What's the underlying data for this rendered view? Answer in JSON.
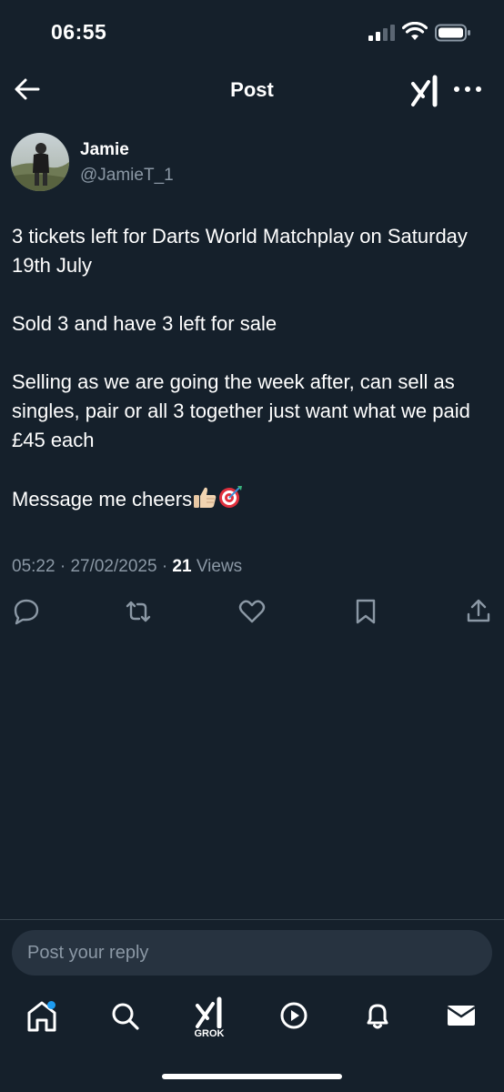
{
  "status_bar": {
    "time": "06:55"
  },
  "header": {
    "title": "Post"
  },
  "author": {
    "name": "Jamie",
    "handle": "@JamieT_1"
  },
  "tweet": {
    "paragraphs": [
      "3 tickets left for Darts World Matchplay on Saturday 19th July",
      "Sold 3 and have 3 left for sale",
      "Selling as we are going the week after, can sell as singles, pair or all 3 together just want what we paid £45 each",
      "Message me cheers"
    ],
    "emoji": [
      "👍🏼",
      "🎯"
    ],
    "time": "05:22",
    "separator": "·",
    "date": "27/02/2025",
    "views_count": "21",
    "views_label": "Views"
  },
  "actions": [
    "reply-icon",
    "retweet-icon",
    "like-icon",
    "bookmark-icon",
    "share-icon"
  ],
  "reply": {
    "placeholder": "Post your reply"
  },
  "tabbar": {
    "grok_label": "GROK",
    "items": [
      "home-icon",
      "search-icon",
      "grok-icon",
      "video-icon",
      "notifications-icon",
      "messages-icon"
    ]
  },
  "colors": {
    "background": "#15202b",
    "muted": "#8b98a5",
    "accent": "#1d9bf0",
    "input_bg": "#273340"
  }
}
